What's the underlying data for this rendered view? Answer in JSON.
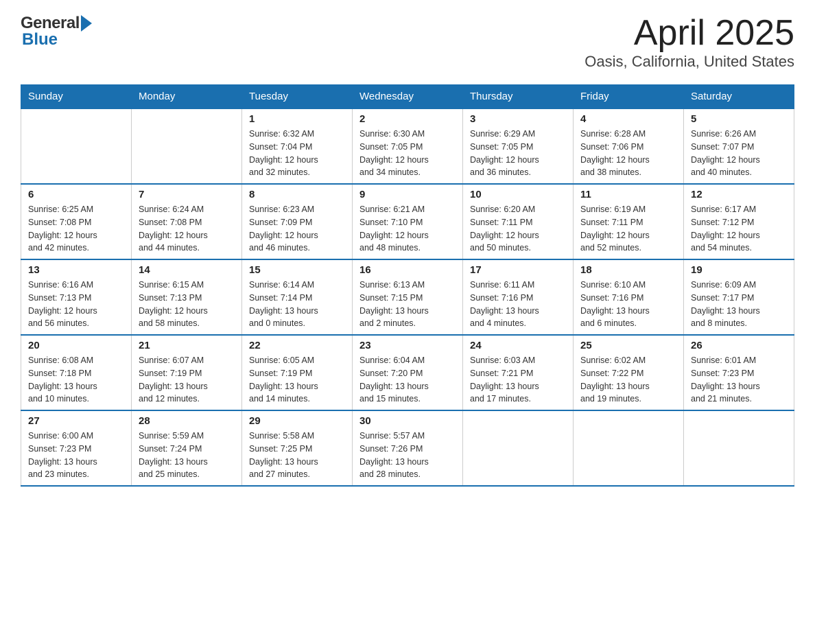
{
  "header": {
    "logo_text1": "General",
    "logo_text2": "Blue",
    "title": "April 2025",
    "subtitle": "Oasis, California, United States"
  },
  "calendar": {
    "weekdays": [
      "Sunday",
      "Monday",
      "Tuesday",
      "Wednesday",
      "Thursday",
      "Friday",
      "Saturday"
    ],
    "weeks": [
      [
        {
          "day": "",
          "info": ""
        },
        {
          "day": "",
          "info": ""
        },
        {
          "day": "1",
          "info": "Sunrise: 6:32 AM\nSunset: 7:04 PM\nDaylight: 12 hours\nand 32 minutes."
        },
        {
          "day": "2",
          "info": "Sunrise: 6:30 AM\nSunset: 7:05 PM\nDaylight: 12 hours\nand 34 minutes."
        },
        {
          "day": "3",
          "info": "Sunrise: 6:29 AM\nSunset: 7:05 PM\nDaylight: 12 hours\nand 36 minutes."
        },
        {
          "day": "4",
          "info": "Sunrise: 6:28 AM\nSunset: 7:06 PM\nDaylight: 12 hours\nand 38 minutes."
        },
        {
          "day": "5",
          "info": "Sunrise: 6:26 AM\nSunset: 7:07 PM\nDaylight: 12 hours\nand 40 minutes."
        }
      ],
      [
        {
          "day": "6",
          "info": "Sunrise: 6:25 AM\nSunset: 7:08 PM\nDaylight: 12 hours\nand 42 minutes."
        },
        {
          "day": "7",
          "info": "Sunrise: 6:24 AM\nSunset: 7:08 PM\nDaylight: 12 hours\nand 44 minutes."
        },
        {
          "day": "8",
          "info": "Sunrise: 6:23 AM\nSunset: 7:09 PM\nDaylight: 12 hours\nand 46 minutes."
        },
        {
          "day": "9",
          "info": "Sunrise: 6:21 AM\nSunset: 7:10 PM\nDaylight: 12 hours\nand 48 minutes."
        },
        {
          "day": "10",
          "info": "Sunrise: 6:20 AM\nSunset: 7:11 PM\nDaylight: 12 hours\nand 50 minutes."
        },
        {
          "day": "11",
          "info": "Sunrise: 6:19 AM\nSunset: 7:11 PM\nDaylight: 12 hours\nand 52 minutes."
        },
        {
          "day": "12",
          "info": "Sunrise: 6:17 AM\nSunset: 7:12 PM\nDaylight: 12 hours\nand 54 minutes."
        }
      ],
      [
        {
          "day": "13",
          "info": "Sunrise: 6:16 AM\nSunset: 7:13 PM\nDaylight: 12 hours\nand 56 minutes."
        },
        {
          "day": "14",
          "info": "Sunrise: 6:15 AM\nSunset: 7:13 PM\nDaylight: 12 hours\nand 58 minutes."
        },
        {
          "day": "15",
          "info": "Sunrise: 6:14 AM\nSunset: 7:14 PM\nDaylight: 13 hours\nand 0 minutes."
        },
        {
          "day": "16",
          "info": "Sunrise: 6:13 AM\nSunset: 7:15 PM\nDaylight: 13 hours\nand 2 minutes."
        },
        {
          "day": "17",
          "info": "Sunrise: 6:11 AM\nSunset: 7:16 PM\nDaylight: 13 hours\nand 4 minutes."
        },
        {
          "day": "18",
          "info": "Sunrise: 6:10 AM\nSunset: 7:16 PM\nDaylight: 13 hours\nand 6 minutes."
        },
        {
          "day": "19",
          "info": "Sunrise: 6:09 AM\nSunset: 7:17 PM\nDaylight: 13 hours\nand 8 minutes."
        }
      ],
      [
        {
          "day": "20",
          "info": "Sunrise: 6:08 AM\nSunset: 7:18 PM\nDaylight: 13 hours\nand 10 minutes."
        },
        {
          "day": "21",
          "info": "Sunrise: 6:07 AM\nSunset: 7:19 PM\nDaylight: 13 hours\nand 12 minutes."
        },
        {
          "day": "22",
          "info": "Sunrise: 6:05 AM\nSunset: 7:19 PM\nDaylight: 13 hours\nand 14 minutes."
        },
        {
          "day": "23",
          "info": "Sunrise: 6:04 AM\nSunset: 7:20 PM\nDaylight: 13 hours\nand 15 minutes."
        },
        {
          "day": "24",
          "info": "Sunrise: 6:03 AM\nSunset: 7:21 PM\nDaylight: 13 hours\nand 17 minutes."
        },
        {
          "day": "25",
          "info": "Sunrise: 6:02 AM\nSunset: 7:22 PM\nDaylight: 13 hours\nand 19 minutes."
        },
        {
          "day": "26",
          "info": "Sunrise: 6:01 AM\nSunset: 7:23 PM\nDaylight: 13 hours\nand 21 minutes."
        }
      ],
      [
        {
          "day": "27",
          "info": "Sunrise: 6:00 AM\nSunset: 7:23 PM\nDaylight: 13 hours\nand 23 minutes."
        },
        {
          "day": "28",
          "info": "Sunrise: 5:59 AM\nSunset: 7:24 PM\nDaylight: 13 hours\nand 25 minutes."
        },
        {
          "day": "29",
          "info": "Sunrise: 5:58 AM\nSunset: 7:25 PM\nDaylight: 13 hours\nand 27 minutes."
        },
        {
          "day": "30",
          "info": "Sunrise: 5:57 AM\nSunset: 7:26 PM\nDaylight: 13 hours\nand 28 minutes."
        },
        {
          "day": "",
          "info": ""
        },
        {
          "day": "",
          "info": ""
        },
        {
          "day": "",
          "info": ""
        }
      ]
    ]
  }
}
